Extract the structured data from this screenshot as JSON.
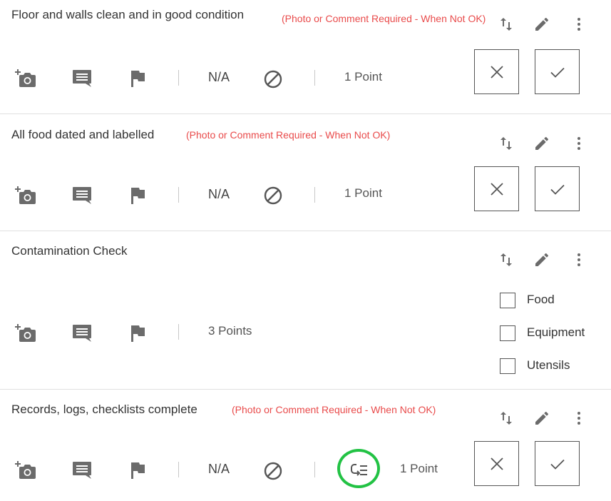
{
  "items": [
    {
      "title": "Floor and walls clean and in good condition",
      "requirement": "(Photo or Comment Required - When Not OK)",
      "na_label": "N/A",
      "points": "1 Point"
    },
    {
      "title": "All food dated and labelled",
      "requirement": "(Photo or Comment Required - When Not OK)",
      "na_label": "N/A",
      "points": "1 Point"
    },
    {
      "title": "Contamination Check",
      "points": "3 Points",
      "options": [
        "Food",
        "Equipment",
        "Utensils"
      ]
    },
    {
      "title": "Records, logs, checklists complete",
      "requirement": "(Photo or Comment Required - When Not OK)",
      "na_label": "N/A",
      "points": "1 Point"
    }
  ],
  "icons": {
    "add_photo": "add-photo-icon",
    "comment": "comment-icon",
    "flag": "flag-icon",
    "not_applicable": "block-icon",
    "reorder": "swap-vert-icon",
    "edit": "pencil-icon",
    "more": "more-vert-icon",
    "fail": "x-icon",
    "pass": "check-icon",
    "logic": "logic-list-icon"
  },
  "colors": {
    "requirement_text": "#e94b4b",
    "highlight_ring": "#22c244",
    "icon": "#6b6b6b"
  }
}
